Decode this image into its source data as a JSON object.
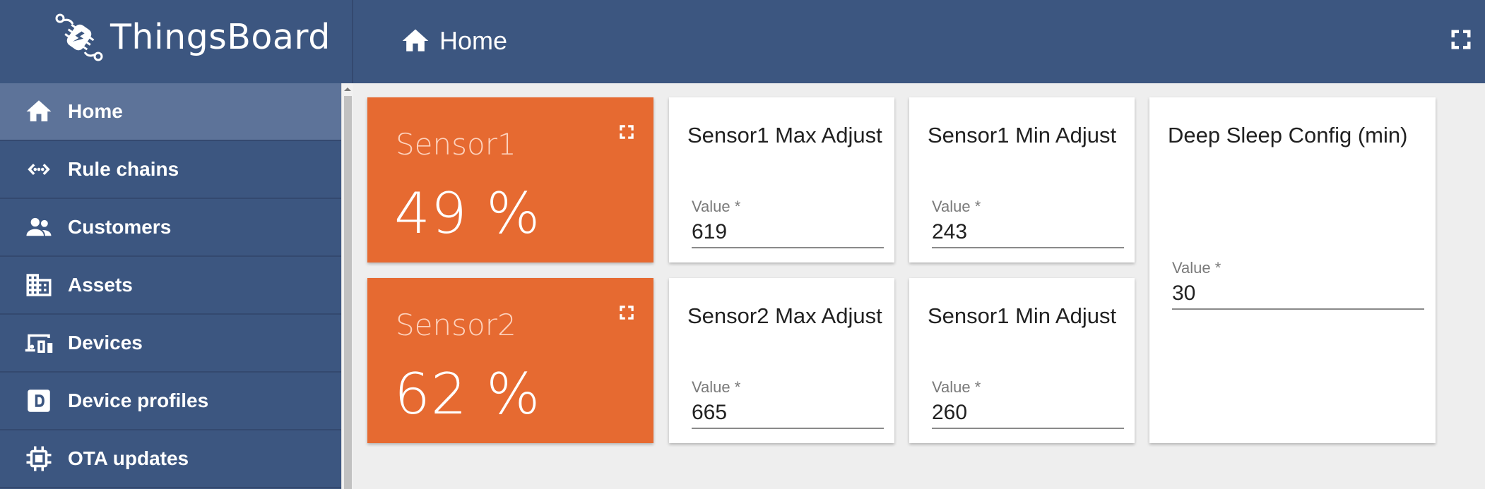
{
  "app": {
    "name": "ThingsBoard"
  },
  "header": {
    "breadcrumb": "Home"
  },
  "sidebar": {
    "items": [
      {
        "label": "Home",
        "icon": "home-icon",
        "active": true
      },
      {
        "label": "Rule chains",
        "icon": "rule-chains-icon"
      },
      {
        "label": "Customers",
        "icon": "customers-icon"
      },
      {
        "label": "Assets",
        "icon": "assets-icon"
      },
      {
        "label": "Devices",
        "icon": "devices-icon"
      },
      {
        "label": "Device profiles",
        "icon": "device-profiles-icon"
      },
      {
        "label": "OTA updates",
        "icon": "ota-updates-icon"
      }
    ]
  },
  "widgets": {
    "sensor1": {
      "title": "Sensor1",
      "value": "49 %"
    },
    "sensor2": {
      "title": "Sensor2",
      "value": "62 %"
    },
    "sensor1_max": {
      "title": "Sensor1 Max Adjust",
      "label": "Value *",
      "value": "619"
    },
    "sensor1_min": {
      "title": "Sensor1 Min Adjust",
      "label": "Value *",
      "value": "243"
    },
    "sensor2_max": {
      "title": "Sensor2 Max Adjust",
      "label": "Value *",
      "value": "665"
    },
    "sensor1_min_2": {
      "title": "Sensor1 Min Adjust",
      "label": "Value *",
      "value": "260"
    },
    "deep_sleep": {
      "title": "Deep Sleep Config (min)",
      "label": "Value *",
      "value": "30"
    }
  },
  "colors": {
    "header": "#3c5680",
    "sidebar_active": "#5d7399",
    "gauge_card": "#e66a31",
    "background": "#eeeeee"
  }
}
